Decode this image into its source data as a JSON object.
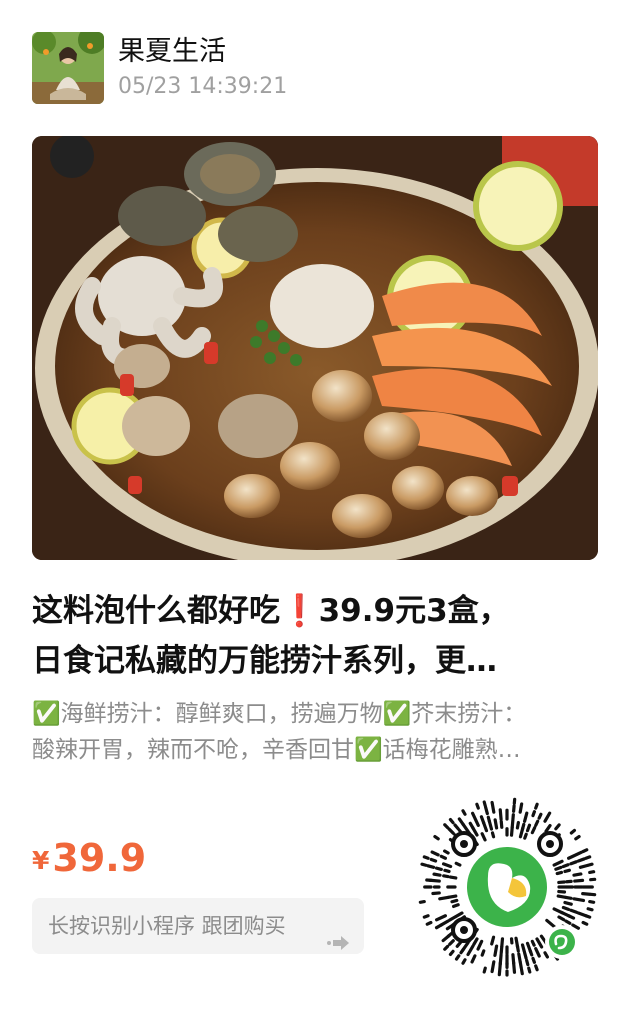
{
  "shop": {
    "name": "果夏生活",
    "timestamp": "05/23 14:39:21"
  },
  "product": {
    "title_line1": "这料泡什么都好吃❗39.9元3盒，",
    "title_line2": "日食记私藏的万能捞汁系列，更…",
    "desc_line1": "✅海鲜捞汁：醇鲜爽口，捞遍万物✅芥末捞汁：",
    "desc_line2": "酸辣开胃，辣而不呛，辛香回甘✅话梅花雕熟…",
    "currency": "¥",
    "price": "39.9"
  },
  "cta": {
    "label": "长按识别小程序 跟团购买"
  },
  "icons": {
    "avatar": "avatar-photo",
    "hero": "seafood-bowl-photo",
    "cta_arrow": "arrow-right-icon",
    "qr": "mini-program-code",
    "qr_center": "heart-leaf-logo-icon",
    "qr_badge": "mini-program-badge-icon"
  },
  "colors": {
    "price": "#f0673a",
    "muted": "#8c8c8c",
    "qr_green": "#3cb34a"
  }
}
